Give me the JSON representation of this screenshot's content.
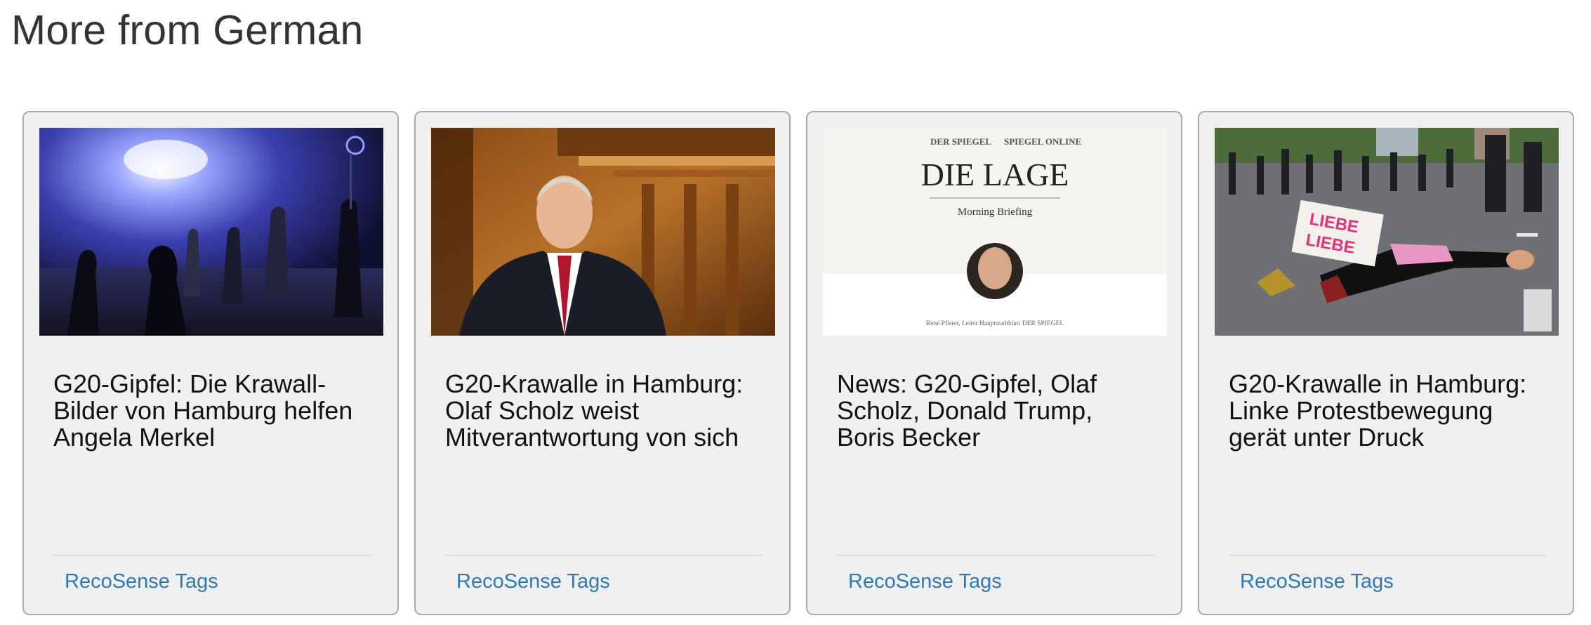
{
  "section": {
    "title": "More from German"
  },
  "cards": [
    {
      "headline": "G20-Gipfel: Die Krawall-Bilder von Hamburg helfen Angela Merkel",
      "tags_label": "RecoSense Tags",
      "image_icon": "photo-night-riot-water-cannon"
    },
    {
      "headline": "G20-Krawalle in Hamburg: Olaf Scholz weist Mitverantwortung von sich",
      "tags_label": "RecoSense Tags",
      "image_icon": "photo-olaf-scholz-portrait"
    },
    {
      "headline": "News: G20-Gipfel, Olaf Scholz, Donald Trump, Boris Becker",
      "tags_label": "RecoSense Tags",
      "image_icon": "die-lage-briefing-graphic",
      "image_text": {
        "brand_left": "DER SPIEGEL",
        "brand_right": "SPIEGEL ONLINE",
        "title": "DIE LAGE",
        "subtitle": "Morning Briefing",
        "caption": "René Pfister, Leiter Hauptstadtbüro DER SPIEGEL"
      }
    },
    {
      "headline": "G20-Krawalle in Hamburg: Linke Protestbewegung gerät unter Druck",
      "tags_label": "RecoSense Tags",
      "image_icon": "photo-street-protest-sign",
      "image_text": {
        "sign_line1": "LIEBE",
        "sign_line2": "LIEBE"
      }
    }
  ],
  "colors": {
    "link": "#2d79b9",
    "card_bg": "#f0f0f0",
    "card_border": "#a9a9a9",
    "title": "#333333"
  }
}
